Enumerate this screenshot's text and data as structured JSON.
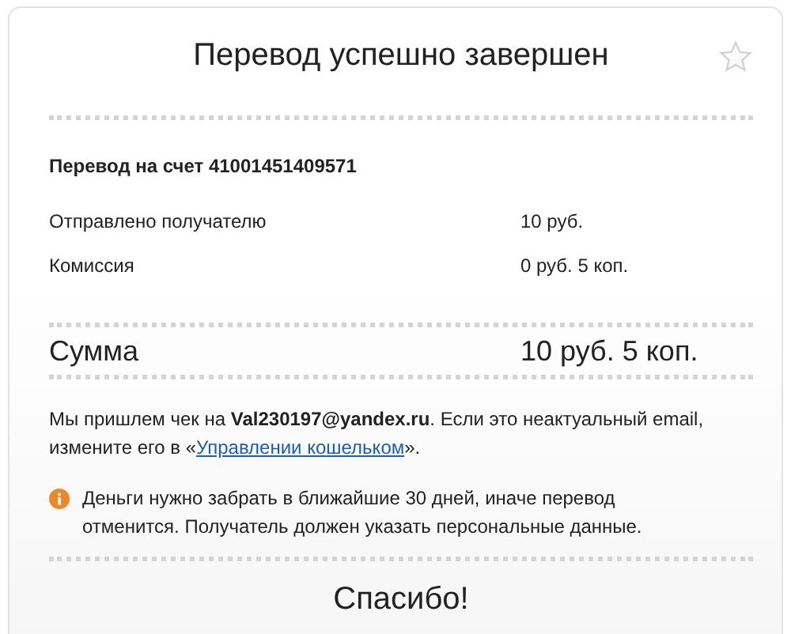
{
  "title": "Перевод успешно завершен",
  "account": "Перевод на счет 41001451409571",
  "rows": [
    {
      "label": "Отправлено получателю",
      "value": "10 руб."
    },
    {
      "label": "Комиссия",
      "value": "0 руб. 5 коп."
    }
  ],
  "total": {
    "label": "Сумма",
    "value": "10 руб. 5 коп."
  },
  "receipt_note": {
    "text": "Мы пришлем чек на **Val230197@yandex.ru**. Если это неактуальный email, измените его в «",
    "link": "Управлении кошельком",
    "text_after": "»."
  },
  "warning": "Деньги нужно забрать в ближайшие 30 дней, иначе перевод отменится. Получатель должен указать персональные данные.",
  "thanks": "Спасибо!"
}
